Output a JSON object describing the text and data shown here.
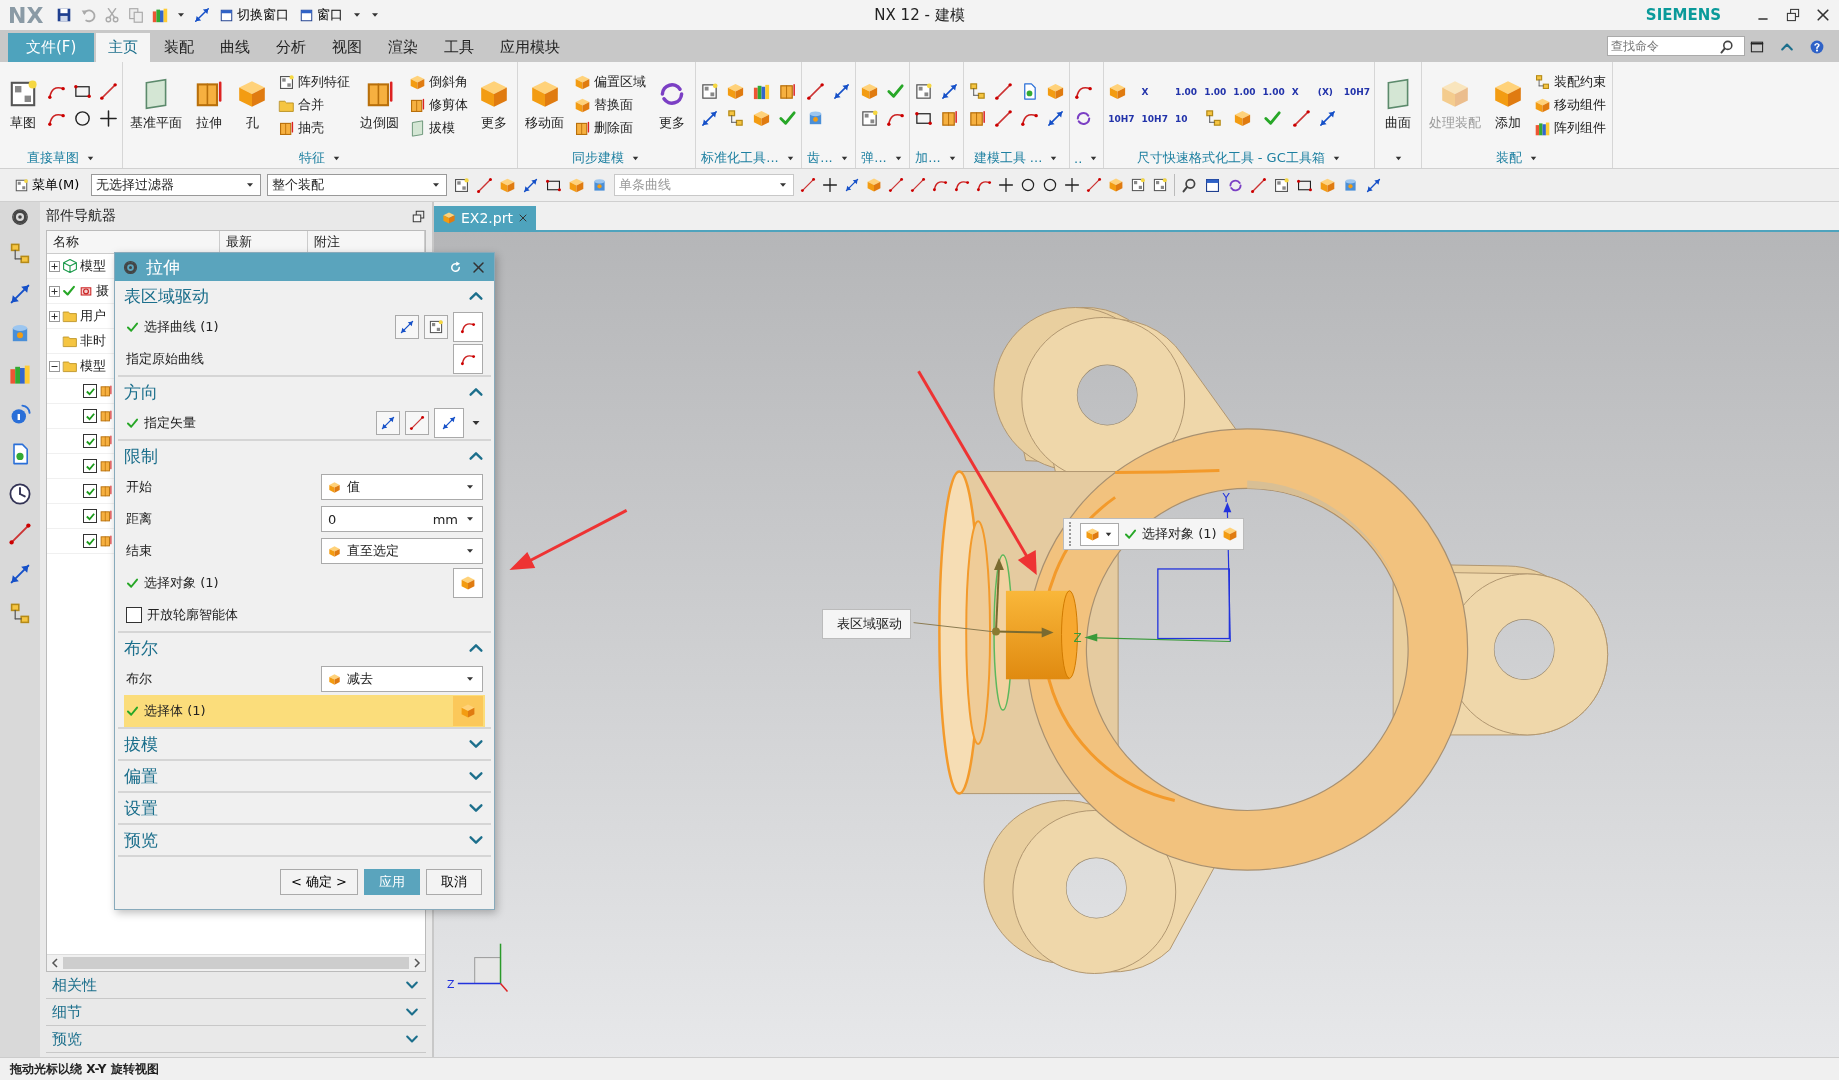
{
  "title_bar": {
    "logo": "NX",
    "quick_buttons": [
      {
        "label": "切换窗口"
      },
      {
        "label": "窗口"
      }
    ],
    "title": "NX 12 - 建模",
    "brand": "SIEMENS"
  },
  "menu_tabs": [
    {
      "label": "文件(F)",
      "kind": "file",
      "selected": false
    },
    {
      "label": "主页",
      "kind": "tab",
      "selected": true
    },
    {
      "label": "装配",
      "kind": "tab",
      "selected": false
    },
    {
      "label": "曲线",
      "kind": "tab",
      "selected": false
    },
    {
      "label": "分析",
      "kind": "tab",
      "selected": false
    },
    {
      "label": "视图",
      "kind": "tab",
      "selected": false
    },
    {
      "label": "渲染",
      "kind": "tab",
      "selected": false
    },
    {
      "label": "工具",
      "kind": "tab",
      "selected": false
    },
    {
      "label": "应用模块",
      "kind": "tab",
      "selected": false
    }
  ],
  "search": {
    "placeholder": "查找命令"
  },
  "ribbon": [
    {
      "label": "直接草图",
      "items": [
        {
          "kind": "large",
          "label": "草图"
        },
        {
          "kind": "icon"
        },
        {
          "kind": "icon"
        },
        {
          "kind": "icon"
        },
        {
          "kind": "icon"
        },
        {
          "kind": "icon"
        },
        {
          "kind": "icon"
        }
      ]
    },
    {
      "label": "特征",
      "items": [
        {
          "kind": "large",
          "label": "基准平面"
        },
        {
          "kind": "large",
          "label": "拉伸"
        },
        {
          "kind": "large",
          "label": "孔"
        },
        {
          "kind": "small",
          "label": "阵列特征"
        },
        {
          "kind": "small",
          "label": "合并"
        },
        {
          "kind": "small",
          "label": "抽壳"
        },
        {
          "kind": "large",
          "label": "边倒圆"
        },
        {
          "kind": "small",
          "label": "倒斜角"
        },
        {
          "kind": "small",
          "label": "修剪体"
        },
        {
          "kind": "small",
          "label": "拔模"
        },
        {
          "kind": "large",
          "label": "更多"
        }
      ]
    },
    {
      "label": "同步建模",
      "items": [
        {
          "kind": "large",
          "label": "移动面"
        },
        {
          "kind": "small",
          "label": "偏置区域"
        },
        {
          "kind": "small",
          "label": "替换面"
        },
        {
          "kind": "small",
          "label": "删除面"
        },
        {
          "kind": "large",
          "label": "更多"
        }
      ]
    },
    {
      "label": "标准化工具...",
      "items": [
        {
          "kind": "icon"
        },
        {
          "kind": "icon"
        },
        {
          "kind": "icon"
        },
        {
          "kind": "icon"
        },
        {
          "kind": "icon"
        },
        {
          "kind": "icon"
        },
        {
          "kind": "icon"
        },
        {
          "kind": "icon"
        }
      ]
    },
    {
      "label": "齿...",
      "items": [
        {
          "kind": "icon"
        },
        {
          "kind": "icon"
        },
        {
          "kind": "icon"
        }
      ]
    },
    {
      "label": "弹...",
      "items": [
        {
          "kind": "icon"
        },
        {
          "kind": "icon"
        },
        {
          "kind": "icon"
        },
        {
          "kind": "icon"
        }
      ]
    },
    {
      "label": "加...",
      "items": [
        {
          "kind": "icon"
        },
        {
          "kind": "icon"
        },
        {
          "kind": "icon"
        },
        {
          "kind": "icon"
        }
      ]
    },
    {
      "label": "建模工具 ...",
      "items": [
        {
          "kind": "icon"
        },
        {
          "kind": "icon"
        },
        {
          "kind": "icon"
        },
        {
          "kind": "icon"
        },
        {
          "kind": "icon"
        },
        {
          "kind": "icon"
        },
        {
          "kind": "icon"
        },
        {
          "kind": "icon"
        }
      ]
    },
    {
      "label": "..",
      "items": [
        {
          "kind": "icon"
        },
        {
          "kind": "icon"
        }
      ]
    },
    {
      "label": "尺寸快速格式化工具 - GC工具箱",
      "items": [
        {
          "kind": "icon"
        },
        {
          "kind": "gc",
          "label": "X"
        },
        {
          "kind": "gc",
          "label": "1.00"
        },
        {
          "kind": "gc",
          "label": "1.00"
        },
        {
          "kind": "gc",
          "label": "1.00"
        },
        {
          "kind": "gc",
          "label": "1.00"
        },
        {
          "kind": "gc",
          "label": "X"
        },
        {
          "kind": "gc",
          "label": "(X)"
        },
        {
          "kind": "gc",
          "label": "10H7"
        },
        {
          "kind": "gc",
          "label": "10H7"
        },
        {
          "kind": "gc",
          "label": "10H7"
        },
        {
          "kind": "gc",
          "label": "10"
        },
        {
          "kind": "icon"
        },
        {
          "kind": "icon"
        },
        {
          "kind": "icon"
        },
        {
          "kind": "icon"
        },
        {
          "kind": "icon"
        }
      ]
    },
    {
      "items": [
        {
          "kind": "large",
          "label": "曲面"
        }
      ]
    },
    {
      "label": "装配",
      "items": [
        {
          "kind": "large",
          "label": "处理装配",
          "disabled": true
        },
        {
          "kind": "large",
          "label": "添加",
          "disabled": false
        },
        {
          "kind": "small",
          "label": "装配约束",
          "disabled": false
        },
        {
          "kind": "small",
          "label": "移动组件",
          "disabled": false
        },
        {
          "kind": "small",
          "label": "阵列组件",
          "disabled": false
        }
      ]
    }
  ],
  "toolbar": {
    "menu": "菜单(M)",
    "selection_filter": "无选择过滤器",
    "scope": "整个装配",
    "curve_rule": {
      "value": "单条曲线",
      "disabled": true
    }
  },
  "navigator": {
    "title": "部件导航器",
    "columns": [
      "名称",
      "最新",
      "附注"
    ],
    "tree": [
      {
        "label": "模型",
        "kind": "model",
        "expanded": false
      },
      {
        "label": "摄",
        "kind": "camera",
        "expanded": false
      },
      {
        "label": "用户",
        "kind": "folder",
        "expanded": false
      },
      {
        "label": "非时",
        "kind": "folder"
      },
      {
        "label": "模型",
        "kind": "folder",
        "expanded": true,
        "children": [
          {
            "checked": true
          },
          {
            "checked": true
          },
          {
            "checked": true
          },
          {
            "checked": true
          },
          {
            "checked": true
          },
          {
            "checked": true
          },
          {
            "checked": true
          }
        ]
      }
    ],
    "sections": [
      {
        "title": "相关性",
        "expanded": false
      },
      {
        "title": "细节",
        "expanded": false
      },
      {
        "title": "预览",
        "expanded": false
      }
    ]
  },
  "viewport": {
    "tab": {
      "label": "EX2.prt",
      "selected": true
    },
    "region_label": "表区域驱动",
    "selection_bar": {
      "label": "选择对象 (1)",
      "done": true
    },
    "axis_y": "Y",
    "axis_z": "Z",
    "triad_z": "Z"
  },
  "dialog": {
    "title": "拉伸",
    "sections": [
      {
        "title": "表区域驱动",
        "expanded": true,
        "rows": [
          {
            "kind": "select",
            "label": "选择曲线 (1)",
            "done": true,
            "selected": false
          },
          {
            "kind": "select",
            "label": "指定原始曲线",
            "done": false,
            "selected": false
          }
        ]
      },
      {
        "title": "方向",
        "expanded": true,
        "rows": [
          {
            "kind": "select",
            "label": "指定矢量",
            "done": true,
            "selected": false
          }
        ]
      },
      {
        "title": "限制",
        "expanded": true,
        "rows": [
          {
            "kind": "dropdown",
            "label": "开始",
            "value": "值"
          },
          {
            "kind": "number",
            "label": "距离",
            "value": "0",
            "unit": "mm"
          },
          {
            "kind": "dropdown",
            "label": "结束",
            "value": "直至选定"
          },
          {
            "kind": "select",
            "label": "选择对象 (1)",
            "done": true,
            "selected": false
          },
          {
            "kind": "checkbox",
            "label": "开放轮廓智能体",
            "checked": false
          }
        ]
      },
      {
        "title": "布尔",
        "expanded": true,
        "rows": [
          {
            "kind": "dropdown",
            "label": "布尔",
            "value": "减去"
          },
          {
            "kind": "select",
            "label": "选择体 (1)",
            "done": true,
            "selected": true
          }
        ]
      },
      {
        "title": "拔模",
        "expanded": false
      },
      {
        "title": "偏置",
        "expanded": false
      },
      {
        "title": "设置",
        "expanded": false
      },
      {
        "title": "预览",
        "expanded": false
      }
    ],
    "buttons": [
      {
        "label": "< 确定 >",
        "kind": "default"
      },
      {
        "label": "应用",
        "kind": "primary"
      },
      {
        "label": "取消",
        "kind": "normal"
      }
    ]
  },
  "status_bar": "拖动光标以绕 X-Y 旋转视图"
}
